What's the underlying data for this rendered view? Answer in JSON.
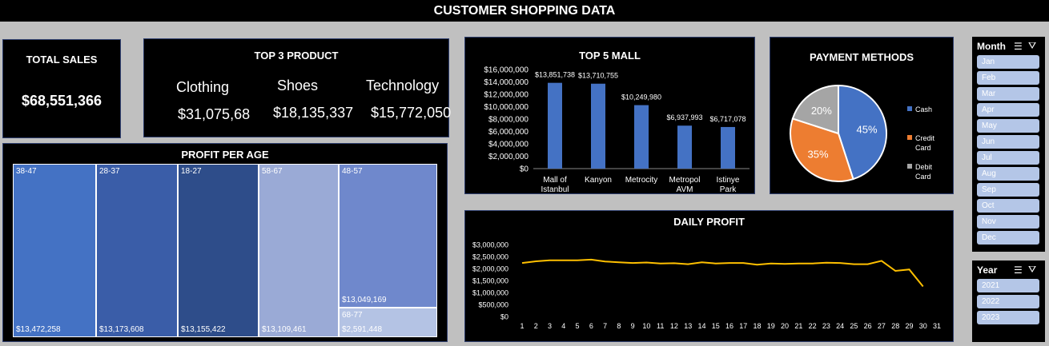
{
  "dashboard_title": "CUSTOMER SHOPPING DATA",
  "total_sales": {
    "title": "TOTAL SALES",
    "value": "$68,551,366"
  },
  "top_products": {
    "title": "TOP 3 PRODUCT",
    "items": [
      {
        "name": "Clothing",
        "value": "$31,075,68"
      },
      {
        "name": "Shoes",
        "value": "$18,135,337"
      },
      {
        "name": "Technology",
        "value": "$15,772,050"
      }
    ]
  },
  "profit_per_age": {
    "title": "PROFIT PER AGE",
    "cells": [
      {
        "label": "38-47",
        "value": "$13,472,258",
        "color": "#4472c4"
      },
      {
        "label": "28-37",
        "value": "$13,173,608",
        "color": "#3a5da8"
      },
      {
        "label": "18-27",
        "value": "$13,155,422",
        "color": "#2e4d8a"
      },
      {
        "label": "58-67",
        "value": "$13,109,461",
        "color": "#9aaad6"
      },
      {
        "label": "48-57",
        "value": "$13,049,169",
        "color": "#6f88cc"
      },
      {
        "label": "68-77",
        "value": "$2,591,448",
        "color": "#b4c3e4"
      }
    ]
  },
  "top5_mall": {
    "title": "TOP 5 MALL"
  },
  "payment": {
    "title": "PAYMENT METHODS"
  },
  "daily_profit": {
    "title": "DAILY PROFIT"
  },
  "month_slicer": {
    "header": "Month",
    "items": [
      "Jan",
      "Feb",
      "Mar",
      "Apr",
      "May",
      "Jun",
      "Jul",
      "Aug",
      "Sep",
      "Oct",
      "Nov",
      "Dec"
    ]
  },
  "year_slicer": {
    "header": "Year",
    "items": [
      "2021",
      "2022",
      "2023"
    ]
  },
  "chart_data": [
    {
      "type": "bar",
      "title": "TOP 5 MALL",
      "categories": [
        "Mall of Istanbul",
        "Kanyon",
        "Metrocity",
        "Metropol AVM",
        "Istinye Park"
      ],
      "category_lines": [
        [
          "Mall of",
          "Istanbul"
        ],
        [
          "Kanyon"
        ],
        [
          "Metrocity"
        ],
        [
          "Metropol",
          "AVM"
        ],
        [
          "Istinye",
          "Park"
        ]
      ],
      "values": [
        13851738,
        13710755,
        10249980,
        6937993,
        6717078
      ],
      "data_labels": [
        "$13,851,738",
        "$13,710,755",
        "$10,249,980",
        "$6,937,993",
        "$6,717,078"
      ],
      "ylim": [
        0,
        16000000
      ],
      "yticks": [
        "$0",
        "$2,000,000",
        "$4,000,000",
        "$6,000,000",
        "$8,000,000",
        "$10,000,000",
        "$12,000,000",
        "$14,000,000",
        "$16,000,000"
      ],
      "color": "#4472c4"
    },
    {
      "type": "pie",
      "title": "PAYMENT METHODS",
      "categories": [
        "Cash",
        "Credit Card",
        "Debit Card"
      ],
      "legend_lines": [
        [
          "Cash"
        ],
        [
          "Credit",
          "Card"
        ],
        [
          "Debit",
          "Card"
        ]
      ],
      "values": [
        45,
        35,
        20
      ],
      "data_labels": [
        "45%",
        "35%",
        "20%"
      ],
      "colors": [
        "#4472c4",
        "#ed7d31",
        "#a5a5a5"
      ],
      "legend": "right"
    },
    {
      "type": "line",
      "title": "DAILY PROFIT",
      "x": [
        1,
        2,
        3,
        4,
        5,
        6,
        7,
        8,
        9,
        10,
        11,
        12,
        13,
        14,
        15,
        16,
        17,
        18,
        19,
        20,
        21,
        22,
        23,
        24,
        25,
        26,
        27,
        28,
        29,
        30,
        31
      ],
      "values": [
        2230000,
        2300000,
        2340000,
        2340000,
        2340000,
        2370000,
        2290000,
        2260000,
        2230000,
        2250000,
        2210000,
        2220000,
        2180000,
        2260000,
        2210000,
        2230000,
        2230000,
        2160000,
        2210000,
        2190000,
        2210000,
        2210000,
        2240000,
        2230000,
        2180000,
        2180000,
        2320000,
        1900000,
        1960000,
        1250000,
        null
      ],
      "ylim": [
        0,
        3000000
      ],
      "yticks": [
        "$0",
        "$500,000",
        "$1,000,000",
        "$1,500,000",
        "$2,000,000",
        "$2,500,000",
        "$3,000,000"
      ],
      "color": "#ffc000"
    }
  ]
}
